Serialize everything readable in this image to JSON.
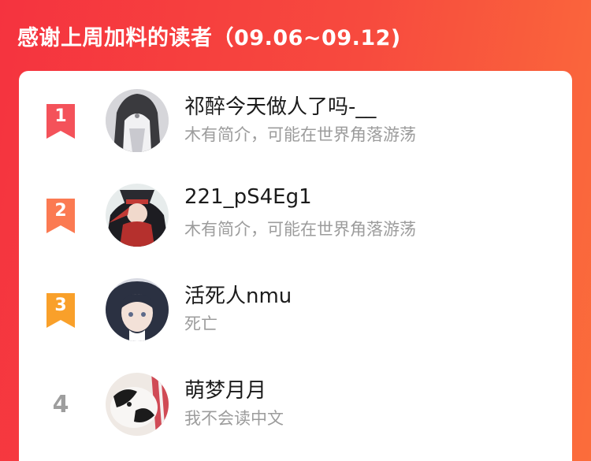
{
  "header": {
    "title": "感谢上周加料的读者（09.06~09.12)"
  },
  "readers": [
    {
      "rank": "1",
      "name": "祁醉今天做人了吗-__",
      "bio": "木有简介，可能在世界角落游荡",
      "badge_color": "#f4525a",
      "avatar_icon": "avatar-photo-icon"
    },
    {
      "rank": "2",
      "name": "221_pS4Eg1",
      "bio": "木有简介，可能在世界角落游荡",
      "badge_color": "#fb7a52",
      "avatar_icon": "avatar-photo-icon"
    },
    {
      "rank": "3",
      "name": "活死人nmu",
      "bio": "死亡",
      "badge_color": "#f9a02a",
      "avatar_icon": "avatar-photo-icon"
    },
    {
      "rank": "4",
      "name": "萌梦月月",
      "bio": "我不会读中文",
      "avatar_icon": "avatar-photo-icon"
    }
  ]
}
